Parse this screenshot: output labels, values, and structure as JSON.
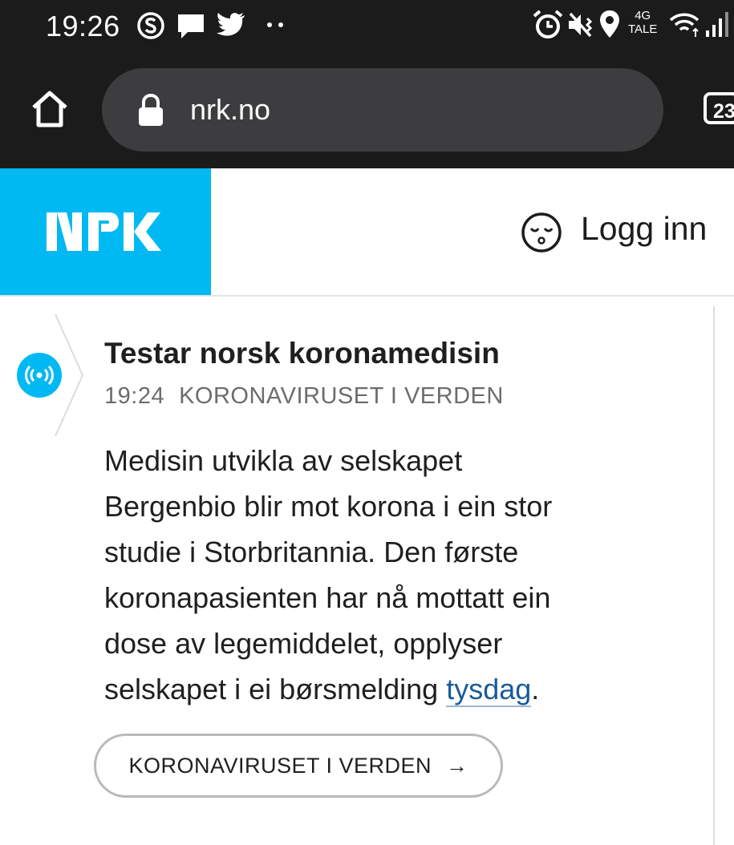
{
  "status_bar": {
    "time": "19:26",
    "network_top": "4G",
    "network_bottom": "TALE",
    "icons": [
      "skype-icon",
      "chat-icon",
      "twitter-icon",
      "more-dots-icon",
      "alarm-icon",
      "vibrate-icon",
      "location-icon",
      "wifi-icon",
      "signal-icon"
    ]
  },
  "browser": {
    "url": "nrk.no",
    "tab_count": "23",
    "icons": [
      "home-icon",
      "lock-icon"
    ]
  },
  "header": {
    "logo_text": "NRK",
    "login_label": "Logg inn",
    "brand_color": "#00b9f2"
  },
  "article": {
    "title": "Testar norsk koronamedisin",
    "time": "19:24",
    "category": "KORONAVIRUSET I VERDEN",
    "body_text": "Medisin utvikla av selskapet Bergenbio blir mot korona i ein stor studie i Storbritannia. Den første koronapasienten har nå mottatt ein dose av legemiddelet, opplyser selskapet i ei børsmelding ",
    "link_text": "tysdag",
    "body_end": ".",
    "tag_button": "KORONAVIRUSET I VERDEN",
    "tag_arrow": "→",
    "link_color": "#1a5a9a"
  }
}
